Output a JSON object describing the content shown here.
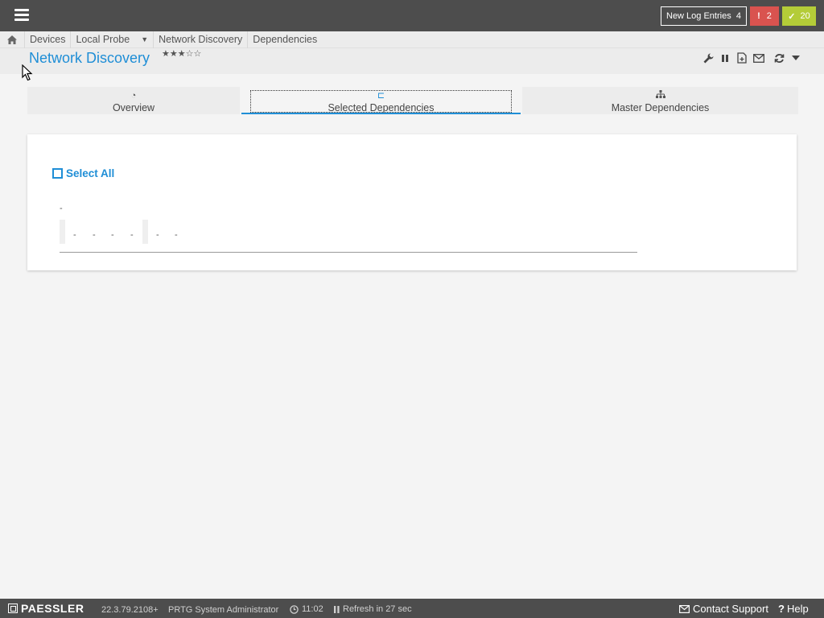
{
  "topbar": {
    "log_label": "New Log Entries",
    "log_count": "4",
    "alarm_icon": "!",
    "alarm_count": "2",
    "ok_icon": "✓",
    "ok_count": "20",
    "colors": {
      "bar": "#4d4d4d",
      "alarm": "#d9534f",
      "ok": "#b4cc38"
    }
  },
  "breadcrumb": {
    "items": [
      "Devices",
      "Local Probe",
      "Network Discovery",
      "Dependencies"
    ],
    "dropdown_glyph": "▼"
  },
  "page": {
    "title": "Network Discovery",
    "stars": "★★★☆☆",
    "accent": "#1f8ed6"
  },
  "tabs": [
    {
      "label": "Overview",
      "icon": "gauge-icon",
      "glyph": "◔"
    },
    {
      "label": "Selected Dependencies",
      "icon": "dependency-icon",
      "glyph": "⊏"
    },
    {
      "label": "Master Dependencies",
      "icon": "sitemap-icon",
      "glyph": "♣"
    }
  ],
  "panel": {
    "select_all": "Select All",
    "dash_top": "-",
    "dashes": [
      "-",
      "-",
      "-",
      "-",
      "-",
      "-"
    ]
  },
  "footer": {
    "brand": "PAESSLER",
    "version": "22.3.79.2108+",
    "user": "PRTG System Administrator",
    "time": "11:02",
    "refresh": "Refresh in 27 sec",
    "contact": "Contact Support",
    "help": "Help"
  }
}
